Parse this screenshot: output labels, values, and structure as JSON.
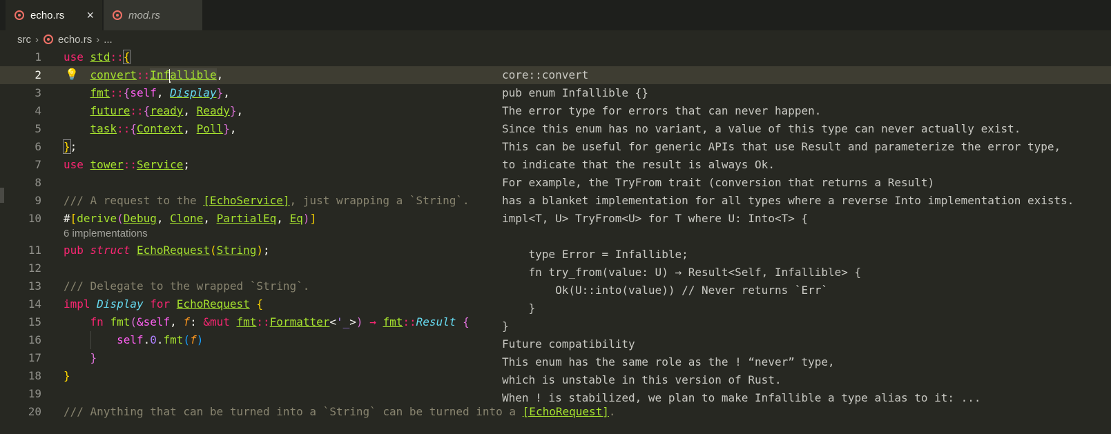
{
  "tabs": [
    {
      "label": "echo.rs",
      "active": true,
      "close": "×"
    },
    {
      "label": "mod.rs",
      "active": false
    }
  ],
  "breadcrumb": {
    "root": "src",
    "file": "echo.rs",
    "more": "..."
  },
  "codelens": "6 implementations",
  "colors": {
    "background": "#272822",
    "keyword": "#f92672",
    "type": "#a6e22e",
    "comment": "#88846f",
    "accent": "#ffcc00"
  },
  "line_numbers": [
    "1",
    "2",
    "3",
    "4",
    "5",
    "6",
    "7",
    "8",
    "9",
    "10",
    "11",
    "12",
    "13",
    "14",
    "15",
    "16",
    "17",
    "18",
    "19",
    "20"
  ],
  "hover_doc": [
    "core::convert",
    "pub enum Infallible {}",
    "The error type for errors that can never happen.",
    "Since this enum has no variant, a value of this type can never actually exist.",
    "This can be useful for generic APIs that use Result and parameterize the error type,",
    "to indicate that the result is always Ok.",
    "For example, the TryFrom trait (conversion that returns a Result)",
    "has a blanket implementation for all types where a reverse Into implementation exists.",
    "impl<T, U> TryFrom<U> for T where U: Into<T> {",
    "",
    "    type Error = Infallible;",
    "    fn try_from(value: U) → Result<Self, Infallible> {",
    "        Ok(U::into(value)) // Never returns `Err`",
    "    }",
    "}",
    "Future compatibility",
    "This enum has the same role as the ! “never” type,",
    "which is unstable in this version of Rust.",
    "When ! is stabilized, we plan to make Infallible a type alias to it: ..."
  ],
  "code": {
    "l1": [
      "use",
      "std",
      "::",
      "{"
    ],
    "l2": [
      "convert",
      "::",
      "Inf",
      "allible",
      ","
    ],
    "l3": [
      "fmt",
      "::",
      "{",
      "self",
      ", ",
      "Display",
      "}",
      ","
    ],
    "l4": [
      "future",
      "::",
      "{",
      "ready",
      ", ",
      "Ready",
      "}",
      ","
    ],
    "l5": [
      "task",
      "::",
      "{",
      "Context",
      ", ",
      "Poll",
      "}",
      ","
    ],
    "l6": [
      "}",
      ";"
    ],
    "l7": [
      "use",
      "tower",
      "::",
      "Service",
      ";"
    ],
    "l9": [
      "/// A request to the ",
      "[EchoService]",
      ", just wrapping a `String`."
    ],
    "l10": [
      "#",
      "[",
      "derive",
      "(",
      "Debug",
      ", ",
      "Clone",
      ", ",
      "PartialEq",
      ", ",
      "Eq",
      ")",
      "]"
    ],
    "l11": [
      "pub",
      "struct",
      "EchoRequest",
      "(",
      "String",
      ")",
      ";"
    ],
    "l13": [
      "/// Delegate to the wrapped `String`."
    ],
    "l14": [
      "impl",
      "Display",
      "for",
      "EchoRequest",
      "{"
    ],
    "l15": [
      "fn",
      "fmt",
      "(",
      "&self",
      ", ",
      "f",
      ": ",
      "&mut",
      "fmt",
      "::",
      "Formatter",
      "<",
      "'_",
      ">",
      ")",
      " → ",
      "fmt",
      "::",
      "Result",
      "{"
    ],
    "l16": [
      "self",
      ".",
      "0",
      ".",
      "fmt",
      "(",
      "f",
      ")"
    ],
    "l17": [
      "}"
    ],
    "l18": [
      "}"
    ],
    "l20": [
      "/// Anything that can be turned into a `String` can be turned into a ",
      "[EchoRequest]",
      "."
    ]
  }
}
